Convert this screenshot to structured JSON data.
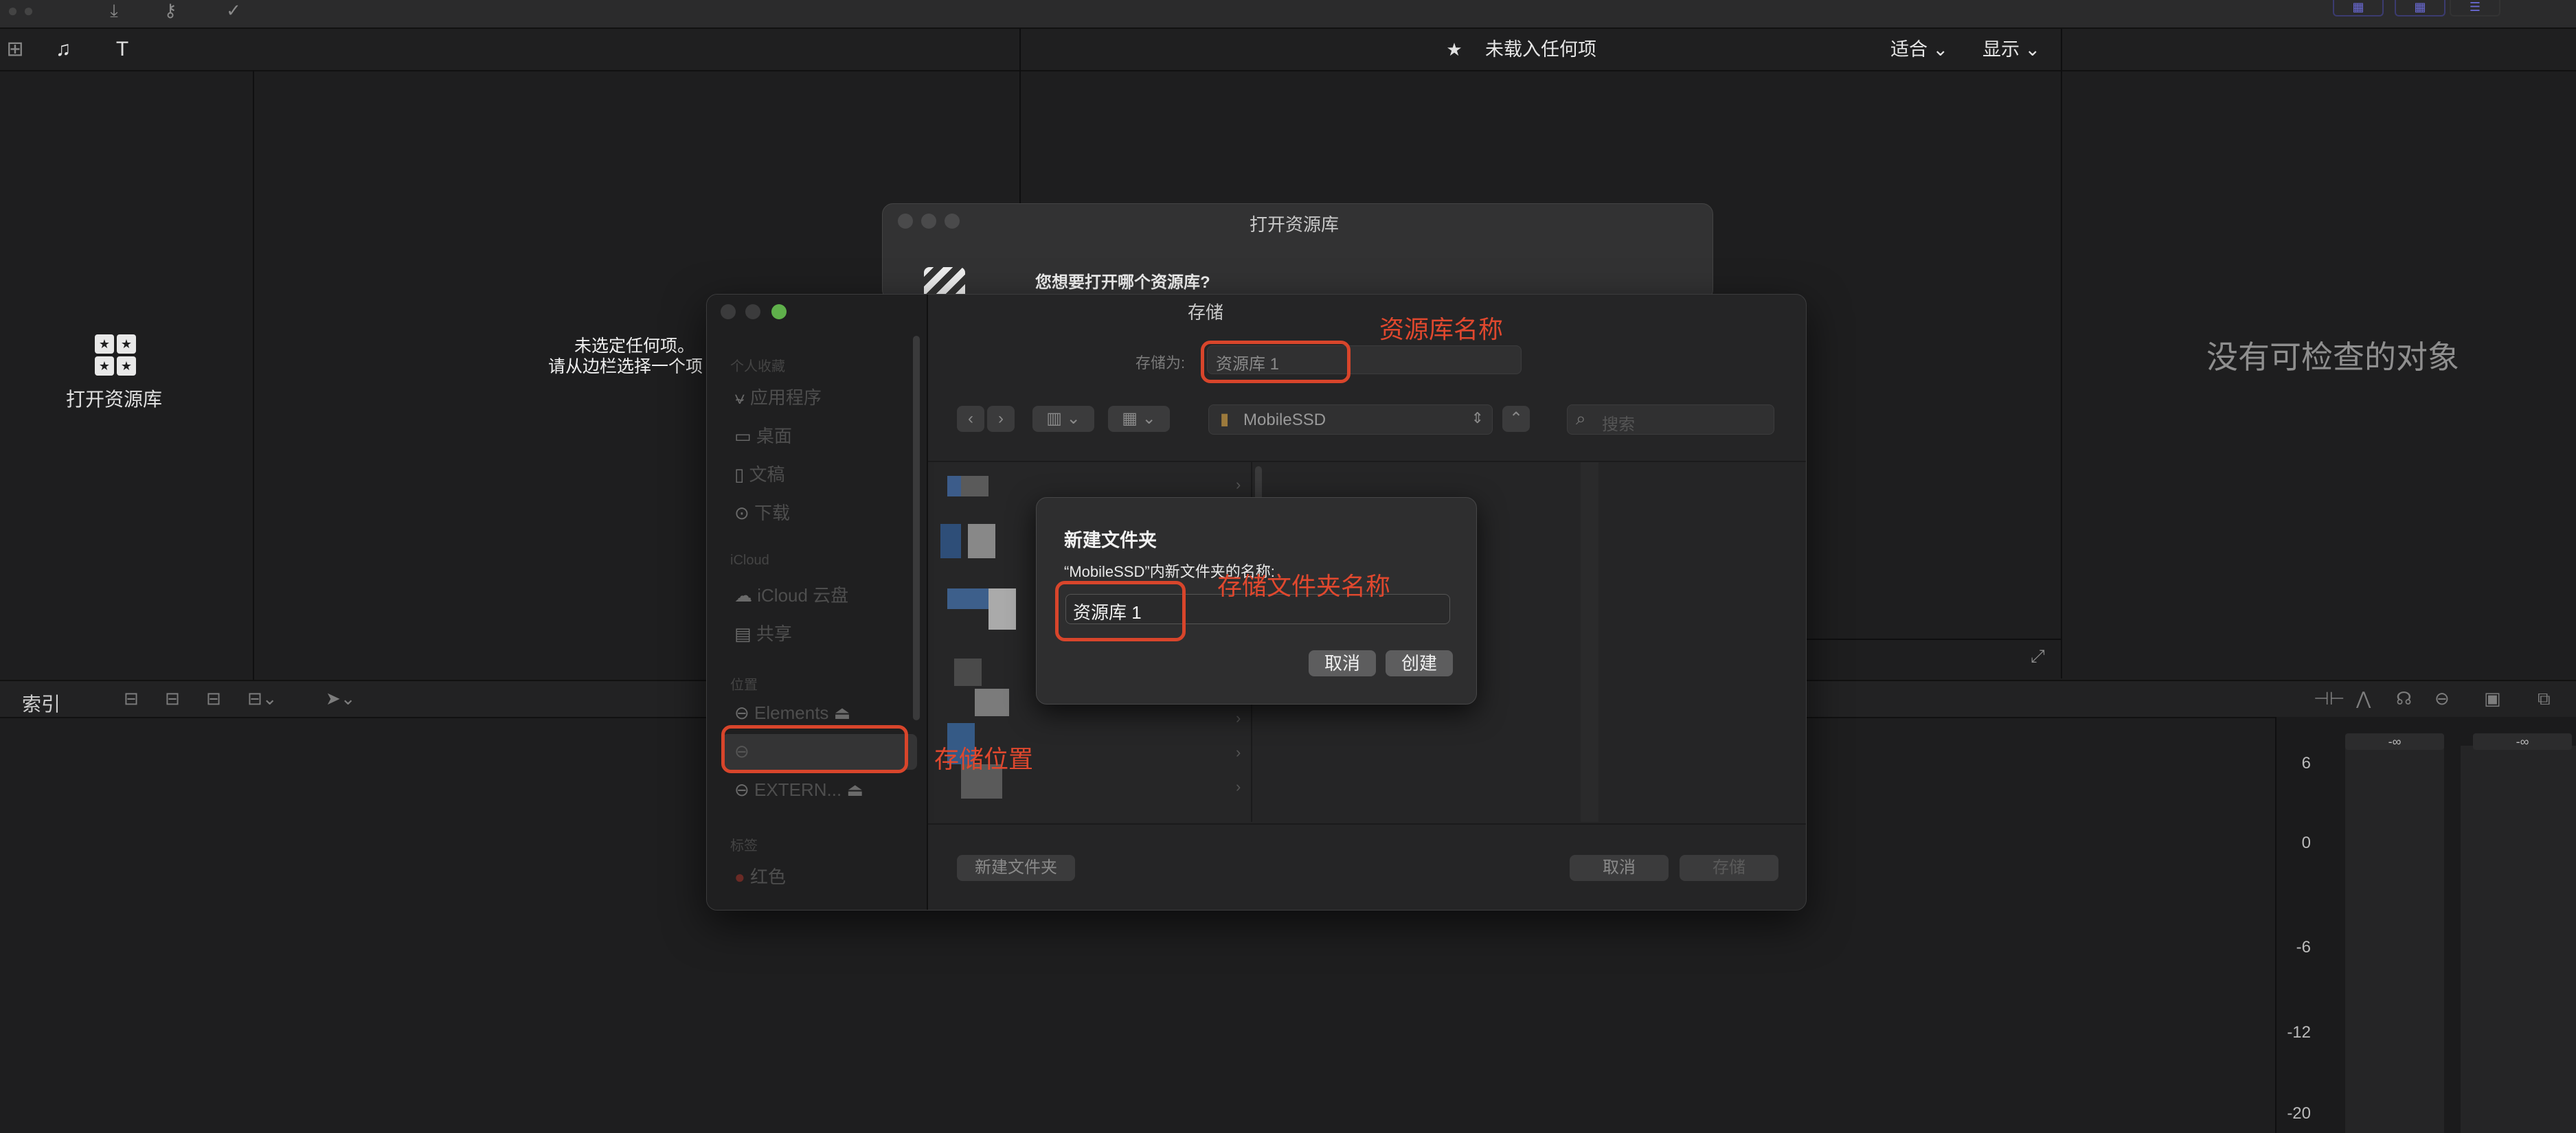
{
  "toolbar": {
    "icons": [
      "download-icon",
      "key-icon",
      "checkmark-icon"
    ],
    "right_buttons": [
      "grid-view-icon",
      "grid-view-2-icon",
      "sliders-icon"
    ]
  },
  "header": {
    "viewer_status": "未载入任何项",
    "fit_label": "适合",
    "display_label": "显示"
  },
  "library_panel": {
    "open_library_label": "打开资源库"
  },
  "browser_panel": {
    "no_selection_line1": "未选定任何项。",
    "no_selection_line2": "请从边栏选择一个项"
  },
  "inspector": {
    "empty_text": "没有可检查的对象"
  },
  "timeline": {
    "index_label": "索引"
  },
  "meter": {
    "scale": [
      "6",
      "0",
      "-6",
      "-12",
      "-20"
    ],
    "peak_left": "-∞",
    "peak_right": "-∞"
  },
  "open_dialog": {
    "title": "打开资源库",
    "question": "您想要打开哪个资源库?"
  },
  "save_dialog": {
    "title": "存储",
    "save_as_label": "存储为:",
    "save_as_value": "资源库 1",
    "location": "MobileSSD",
    "search_placeholder": "搜索",
    "sidebar": {
      "favorites_header": "个人收藏",
      "items_favorites": [
        "应用程序",
        "桌面",
        "文稿",
        "下载"
      ],
      "icloud_header": "iCloud",
      "items_icloud": [
        "iCloud 云盘",
        "共享"
      ],
      "locations_header": "位置",
      "items_locations": [
        "Elements",
        "",
        "EXTERN..."
      ],
      "tags_header": "标签",
      "items_tags": [
        "红色"
      ]
    },
    "new_folder_button": "新建文件夹",
    "cancel_button": "取消",
    "save_button": "存储"
  },
  "new_folder_dialog": {
    "title": "新建文件夹",
    "prompt": "“MobileSSD”内新文件夹的名称:",
    "name_value": "资源库 1",
    "cancel_button": "取消",
    "create_button": "创建"
  },
  "annotations": {
    "library_name": "资源库名称",
    "folder_name": "存储文件夹名称",
    "storage_location": "存储位置",
    "color": "#d8452b"
  }
}
